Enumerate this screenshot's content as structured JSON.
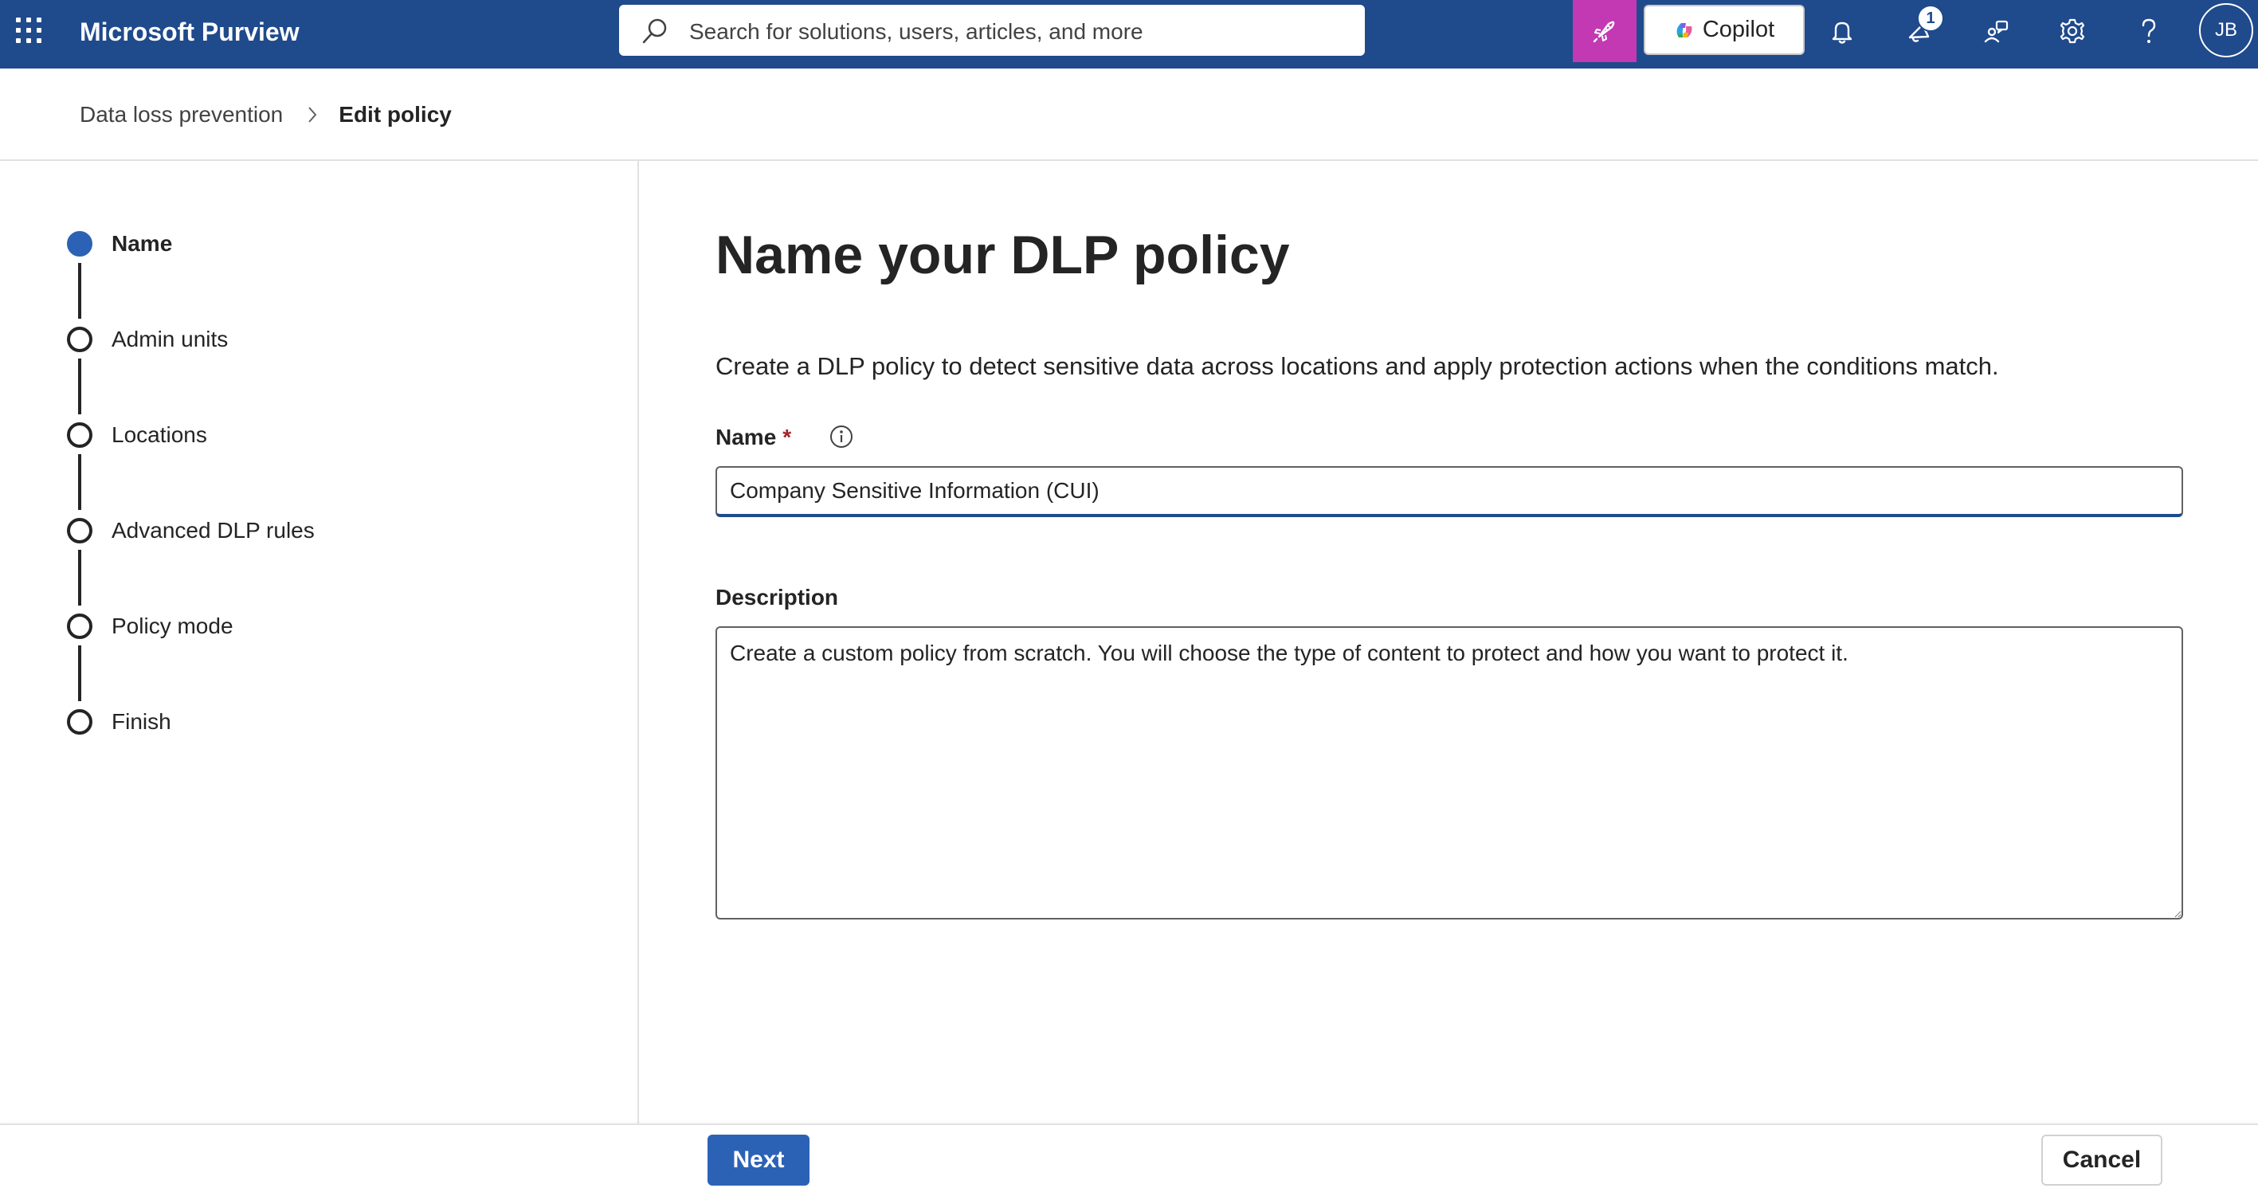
{
  "topbar": {
    "waffle_icon": "app-launcher-icon",
    "app_title": "Microsoft Purview",
    "search_placeholder": "Search for solutions, users, articles, and more",
    "copilot_label": "Copilot",
    "notification_count": "1",
    "avatar_initials": "JB",
    "brand_color": "#1f4a8c",
    "accent_magenta": "#c239b3",
    "icons": [
      "search-icon",
      "rocket-icon",
      "copilot-icon",
      "bell-icon",
      "announcement-icon",
      "feedback-icon",
      "gear-icon",
      "help-icon"
    ]
  },
  "breadcrumb": {
    "parent": "Data loss prevention",
    "current": "Edit policy"
  },
  "wizard": {
    "steps": [
      {
        "label": "Name",
        "active": true
      },
      {
        "label": "Admin units",
        "active": false
      },
      {
        "label": "Locations",
        "active": false
      },
      {
        "label": "Advanced DLP rules",
        "active": false
      },
      {
        "label": "Policy mode",
        "active": false
      },
      {
        "label": "Finish",
        "active": false
      }
    ],
    "active_color": "#2c62b5"
  },
  "main": {
    "title": "Name your DLP policy",
    "description": "Create a DLP policy to detect sensitive data across locations and apply protection actions when the conditions match.",
    "name_field": {
      "label": "Name",
      "required_marker": "*",
      "value": "Company Sensitive Information (CUI)"
    },
    "description_field": {
      "label": "Description",
      "value": "Create a custom policy from scratch. You will choose the type of content to protect and how you want to protect it."
    }
  },
  "footer": {
    "next_label": "Next",
    "cancel_label": "Cancel"
  }
}
